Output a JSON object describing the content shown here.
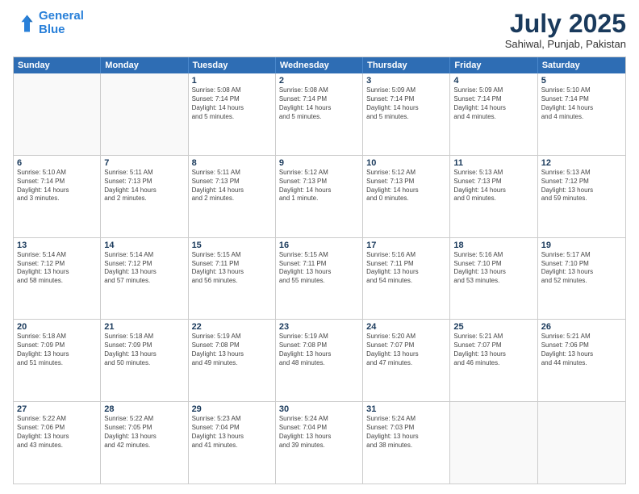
{
  "logo": {
    "line1": "General",
    "line2": "Blue"
  },
  "title": "July 2025",
  "location": "Sahiwal, Punjab, Pakistan",
  "header_days": [
    "Sunday",
    "Monday",
    "Tuesday",
    "Wednesday",
    "Thursday",
    "Friday",
    "Saturday"
  ],
  "weeks": [
    [
      {
        "day": "",
        "info": ""
      },
      {
        "day": "",
        "info": ""
      },
      {
        "day": "1",
        "info": "Sunrise: 5:08 AM\nSunset: 7:14 PM\nDaylight: 14 hours\nand 5 minutes."
      },
      {
        "day": "2",
        "info": "Sunrise: 5:08 AM\nSunset: 7:14 PM\nDaylight: 14 hours\nand 5 minutes."
      },
      {
        "day": "3",
        "info": "Sunrise: 5:09 AM\nSunset: 7:14 PM\nDaylight: 14 hours\nand 5 minutes."
      },
      {
        "day": "4",
        "info": "Sunrise: 5:09 AM\nSunset: 7:14 PM\nDaylight: 14 hours\nand 4 minutes."
      },
      {
        "day": "5",
        "info": "Sunrise: 5:10 AM\nSunset: 7:14 PM\nDaylight: 14 hours\nand 4 minutes."
      }
    ],
    [
      {
        "day": "6",
        "info": "Sunrise: 5:10 AM\nSunset: 7:14 PM\nDaylight: 14 hours\nand 3 minutes."
      },
      {
        "day": "7",
        "info": "Sunrise: 5:11 AM\nSunset: 7:13 PM\nDaylight: 14 hours\nand 2 minutes."
      },
      {
        "day": "8",
        "info": "Sunrise: 5:11 AM\nSunset: 7:13 PM\nDaylight: 14 hours\nand 2 minutes."
      },
      {
        "day": "9",
        "info": "Sunrise: 5:12 AM\nSunset: 7:13 PM\nDaylight: 14 hours\nand 1 minute."
      },
      {
        "day": "10",
        "info": "Sunrise: 5:12 AM\nSunset: 7:13 PM\nDaylight: 14 hours\nand 0 minutes."
      },
      {
        "day": "11",
        "info": "Sunrise: 5:13 AM\nSunset: 7:13 PM\nDaylight: 14 hours\nand 0 minutes."
      },
      {
        "day": "12",
        "info": "Sunrise: 5:13 AM\nSunset: 7:12 PM\nDaylight: 13 hours\nand 59 minutes."
      }
    ],
    [
      {
        "day": "13",
        "info": "Sunrise: 5:14 AM\nSunset: 7:12 PM\nDaylight: 13 hours\nand 58 minutes."
      },
      {
        "day": "14",
        "info": "Sunrise: 5:14 AM\nSunset: 7:12 PM\nDaylight: 13 hours\nand 57 minutes."
      },
      {
        "day": "15",
        "info": "Sunrise: 5:15 AM\nSunset: 7:11 PM\nDaylight: 13 hours\nand 56 minutes."
      },
      {
        "day": "16",
        "info": "Sunrise: 5:15 AM\nSunset: 7:11 PM\nDaylight: 13 hours\nand 55 minutes."
      },
      {
        "day": "17",
        "info": "Sunrise: 5:16 AM\nSunset: 7:11 PM\nDaylight: 13 hours\nand 54 minutes."
      },
      {
        "day": "18",
        "info": "Sunrise: 5:16 AM\nSunset: 7:10 PM\nDaylight: 13 hours\nand 53 minutes."
      },
      {
        "day": "19",
        "info": "Sunrise: 5:17 AM\nSunset: 7:10 PM\nDaylight: 13 hours\nand 52 minutes."
      }
    ],
    [
      {
        "day": "20",
        "info": "Sunrise: 5:18 AM\nSunset: 7:09 PM\nDaylight: 13 hours\nand 51 minutes."
      },
      {
        "day": "21",
        "info": "Sunrise: 5:18 AM\nSunset: 7:09 PM\nDaylight: 13 hours\nand 50 minutes."
      },
      {
        "day": "22",
        "info": "Sunrise: 5:19 AM\nSunset: 7:08 PM\nDaylight: 13 hours\nand 49 minutes."
      },
      {
        "day": "23",
        "info": "Sunrise: 5:19 AM\nSunset: 7:08 PM\nDaylight: 13 hours\nand 48 minutes."
      },
      {
        "day": "24",
        "info": "Sunrise: 5:20 AM\nSunset: 7:07 PM\nDaylight: 13 hours\nand 47 minutes."
      },
      {
        "day": "25",
        "info": "Sunrise: 5:21 AM\nSunset: 7:07 PM\nDaylight: 13 hours\nand 46 minutes."
      },
      {
        "day": "26",
        "info": "Sunrise: 5:21 AM\nSunset: 7:06 PM\nDaylight: 13 hours\nand 44 minutes."
      }
    ],
    [
      {
        "day": "27",
        "info": "Sunrise: 5:22 AM\nSunset: 7:06 PM\nDaylight: 13 hours\nand 43 minutes."
      },
      {
        "day": "28",
        "info": "Sunrise: 5:22 AM\nSunset: 7:05 PM\nDaylight: 13 hours\nand 42 minutes."
      },
      {
        "day": "29",
        "info": "Sunrise: 5:23 AM\nSunset: 7:04 PM\nDaylight: 13 hours\nand 41 minutes."
      },
      {
        "day": "30",
        "info": "Sunrise: 5:24 AM\nSunset: 7:04 PM\nDaylight: 13 hours\nand 39 minutes."
      },
      {
        "day": "31",
        "info": "Sunrise: 5:24 AM\nSunset: 7:03 PM\nDaylight: 13 hours\nand 38 minutes."
      },
      {
        "day": "",
        "info": ""
      },
      {
        "day": "",
        "info": ""
      }
    ]
  ]
}
